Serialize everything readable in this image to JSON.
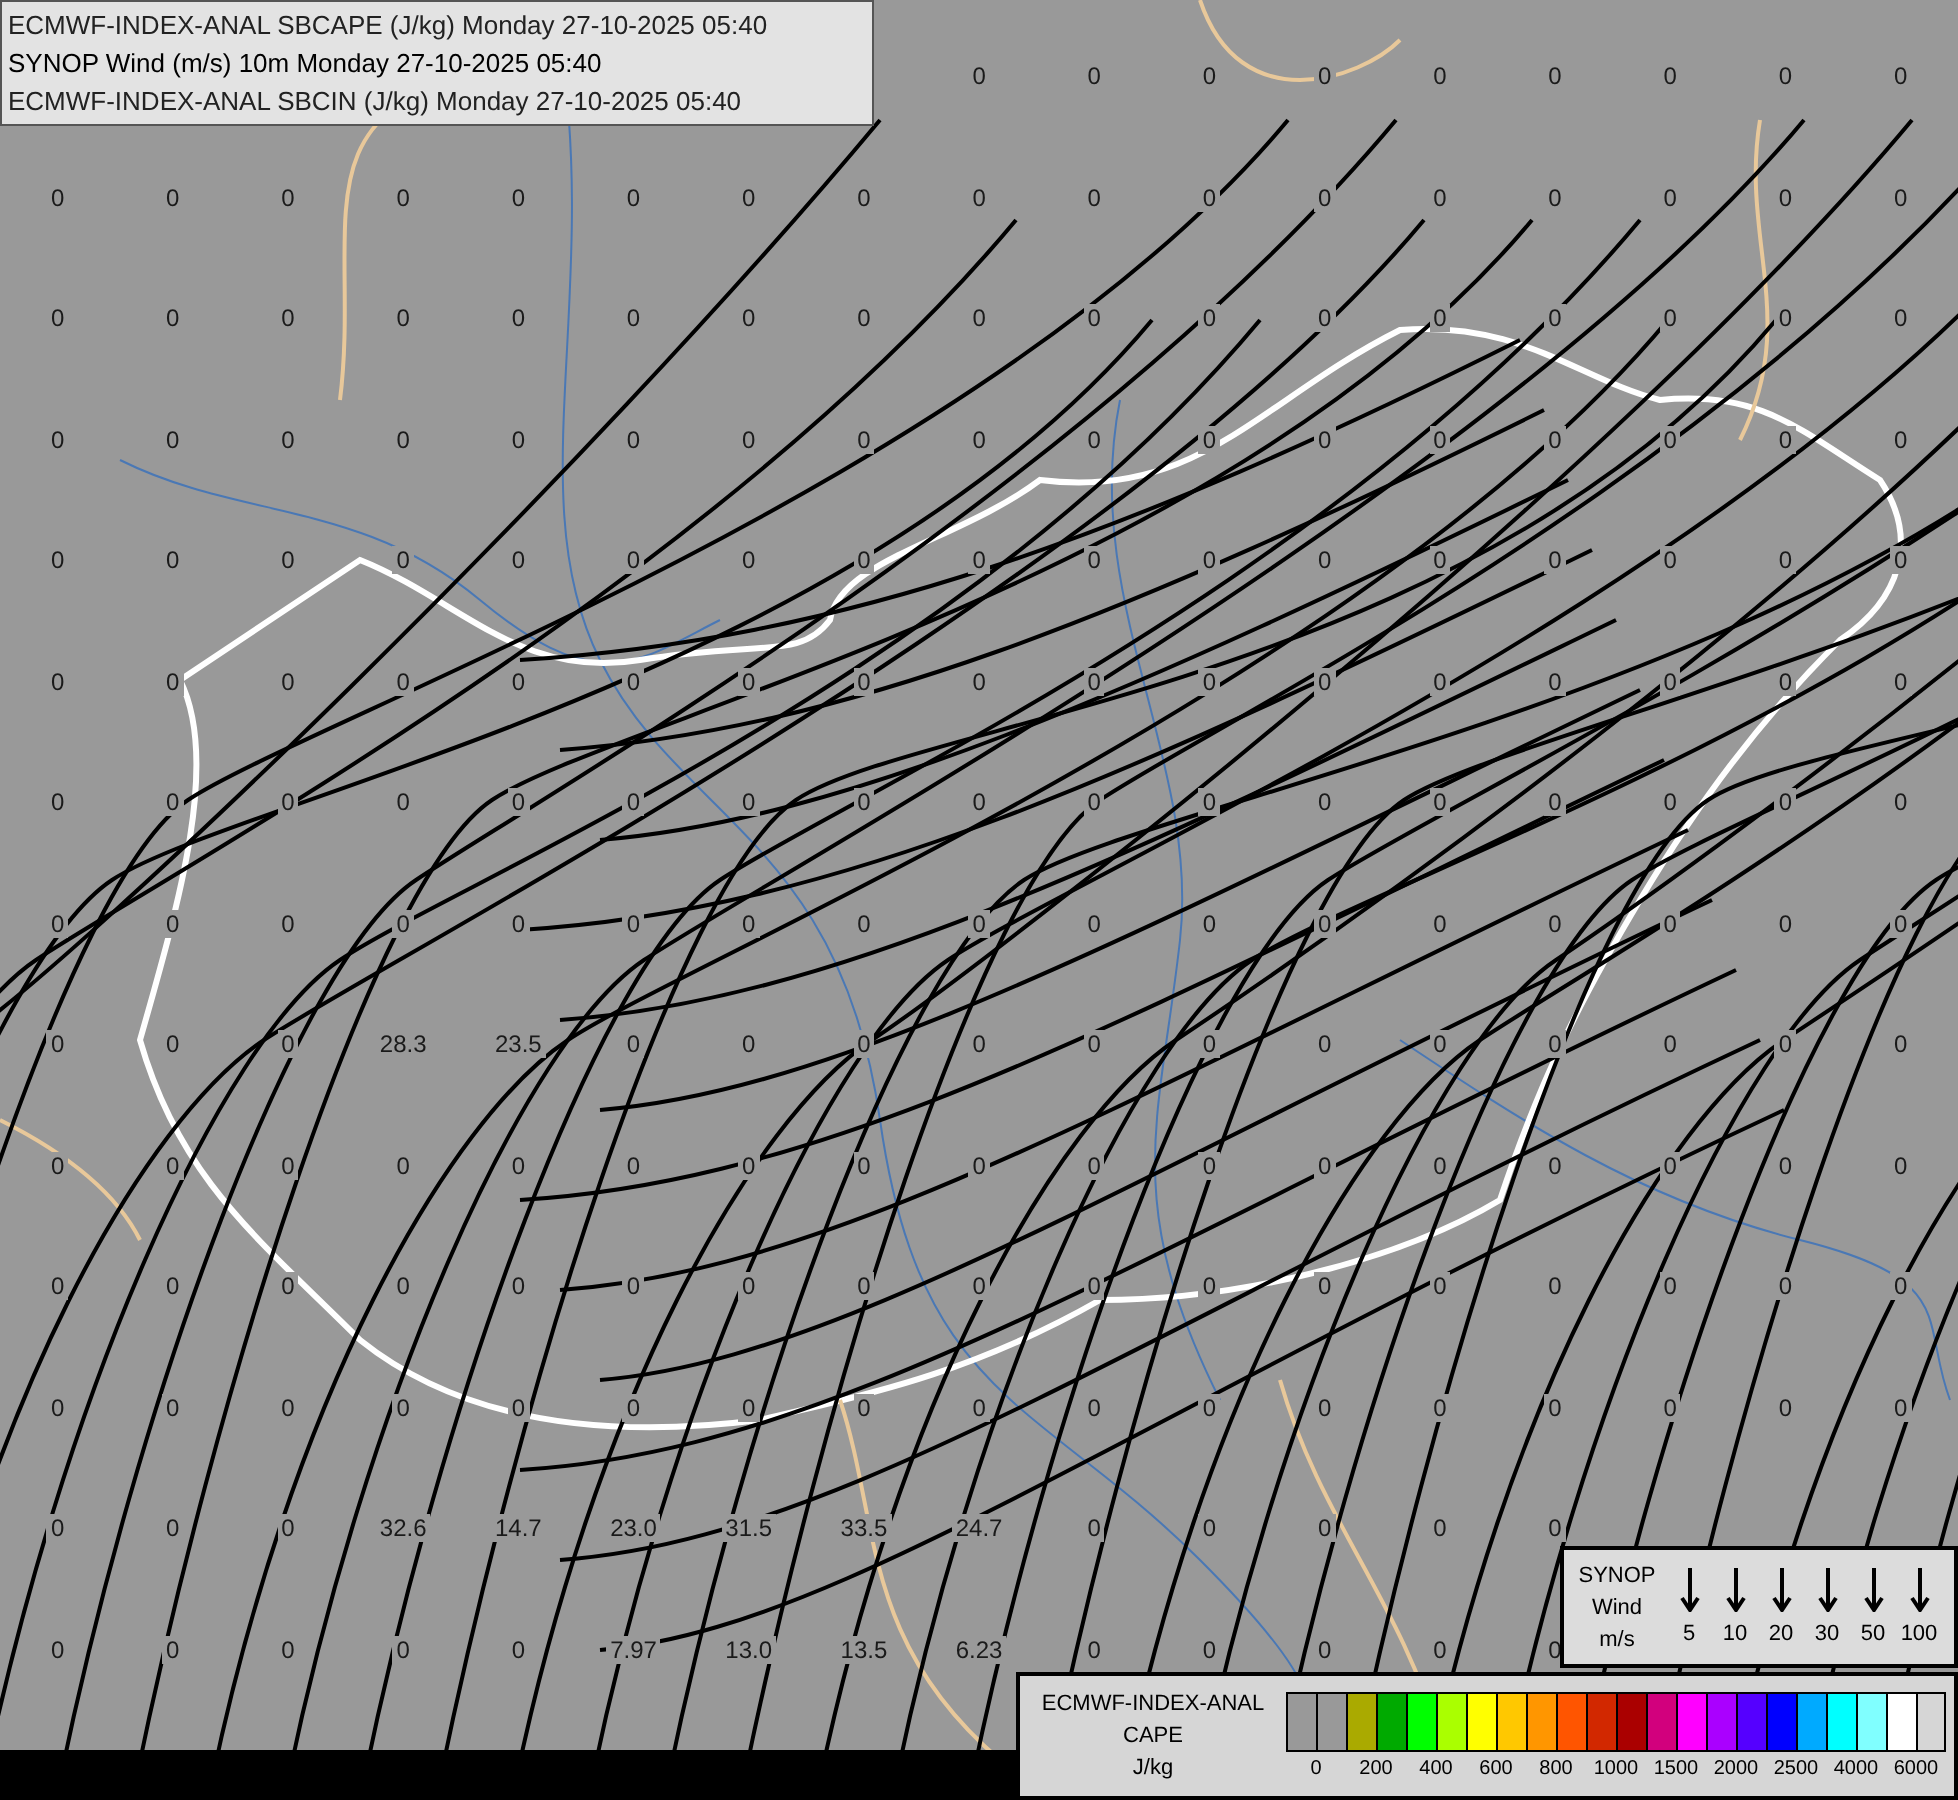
{
  "title_box": {
    "lines": [
      "ECMWF-INDEX-ANAL SBCAPE (J/kg) Monday 27-10-2025 05:40",
      "SYNOP Wind (m/s) 10m Monday 27-10-2025 05:40",
      "ECMWF-INDEX-ANAL SBCIN (J/kg) Monday 27-10-2025 05:40"
    ]
  },
  "field_labels": {
    "rows": [
      [
        null,
        null,
        null,
        null,
        null,
        null,
        null,
        null,
        "0",
        "0",
        "0",
        "0",
        "0",
        "0",
        "0",
        "0",
        "0"
      ],
      [
        "0",
        "0",
        "0",
        "0",
        "0",
        "0",
        "0",
        "0",
        "0",
        "0",
        "0",
        "0",
        "0",
        "0",
        "0",
        "0",
        "0"
      ],
      [
        "0",
        "0",
        "0",
        "0",
        "0",
        "0",
        "0",
        "0",
        "0",
        "0",
        "0",
        "0",
        "0",
        "0",
        "0",
        "0",
        "0"
      ],
      [
        "0",
        "0",
        "0",
        "0",
        "0",
        "0",
        "0",
        "0",
        "0",
        "0",
        "0",
        "0",
        "0",
        "0",
        "0",
        "0",
        "0"
      ],
      [
        "0",
        "0",
        "0",
        "0",
        "0",
        "0",
        "0",
        "0",
        "0",
        "0",
        "0",
        "0",
        "0",
        "0",
        "0",
        "0",
        "0"
      ],
      [
        "0",
        "0",
        "0",
        "0",
        "0",
        "0",
        "0",
        "0",
        "0",
        "0",
        "0",
        "0",
        "0",
        "0",
        "0",
        "0",
        "0"
      ],
      [
        "0",
        "0",
        "0",
        "0",
        "0",
        "0",
        "0",
        "0",
        "0",
        "0",
        "0",
        "0",
        "0",
        "0",
        "0",
        "0",
        "0"
      ],
      [
        "0",
        "0",
        "0",
        "0",
        "0",
        "0",
        "0",
        "0",
        "0",
        "0",
        "0",
        "0",
        "0",
        "0",
        "0",
        "0",
        "0"
      ],
      [
        "0",
        "0",
        "0",
        "28.3",
        "23.5",
        "0",
        "0",
        "0",
        "0",
        "0",
        "0",
        "0",
        "0",
        "0",
        "0",
        "0",
        "0"
      ],
      [
        "0",
        "0",
        "0",
        "0",
        "0",
        "0",
        "0",
        "0",
        "0",
        "0",
        "0",
        "0",
        "0",
        "0",
        "0",
        "0",
        "0"
      ],
      [
        "0",
        "0",
        "0",
        "0",
        "0",
        "0",
        "0",
        "0",
        "0",
        "0",
        "0",
        "0",
        "0",
        "0",
        "0",
        "0",
        "0"
      ],
      [
        "0",
        "0",
        "0",
        "0",
        "0",
        "0",
        "0",
        "0",
        "0",
        "0",
        "0",
        "0",
        "0",
        "0",
        "0",
        "0",
        "0"
      ],
      [
        "0",
        "0",
        "0",
        "32.6",
        "14.7",
        "23.0",
        "31.5",
        "33.5",
        "24.7",
        "0",
        "0",
        "0",
        "0",
        "0",
        null,
        null,
        null
      ],
      [
        "0",
        "0",
        "0",
        "0",
        "0",
        "7.97",
        "13.0",
        "13.5",
        "6.23",
        "0",
        "0",
        "0",
        "0",
        "0",
        null,
        null,
        null
      ]
    ]
  },
  "wind_legend": {
    "title_lines": [
      "SYNOP",
      "Wind",
      "m/s"
    ],
    "speeds": [
      "5",
      "10",
      "20",
      "30",
      "50",
      "100"
    ]
  },
  "cape_legend": {
    "title_lines": [
      "ECMWF-INDEX-ANAL",
      "CAPE",
      "J/kg"
    ],
    "swatches": [
      {
        "color": "#999999"
      },
      {
        "color": "#999999"
      },
      {
        "color": "#aaaa00"
      },
      {
        "color": "#00aa00"
      },
      {
        "color": "#00ff00"
      },
      {
        "color": "#aaff00"
      },
      {
        "color": "#ffff00"
      },
      {
        "color": "#ffc800"
      },
      {
        "color": "#ff9600"
      },
      {
        "color": "#ff5500"
      },
      {
        "color": "#d22800"
      },
      {
        "color": "#aa0000"
      },
      {
        "color": "#d2007d"
      },
      {
        "color": "#ff00ff"
      },
      {
        "color": "#aa00ff"
      },
      {
        "color": "#5500ff"
      },
      {
        "color": "#0000ff"
      },
      {
        "color": "#00aaff"
      },
      {
        "color": "#00ffff"
      },
      {
        "color": "#80ffff"
      },
      {
        "color": "#ffffff"
      }
    ],
    "ticks": [
      "0",
      "200",
      "400",
      "600",
      "800",
      "1000",
      "1500",
      "2000",
      "2500",
      "4000",
      "6000"
    ]
  }
}
